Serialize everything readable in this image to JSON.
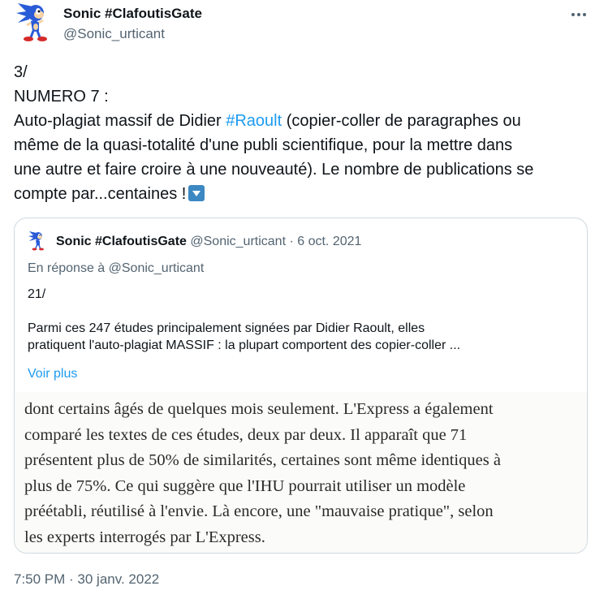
{
  "tweet": {
    "author": {
      "name": "Sonic #ClafoutisGate",
      "handle": "@Sonic_urticant"
    },
    "text": {
      "line1": "3/",
      "line2": "NUMERO 7 :",
      "line3_before": "Auto-plagiat massif de Didier ",
      "hashtag": "#Raoult",
      "line3_after": " (copier-coller de paragraphes ou",
      "line4": "même de la quasi-totalité d'une publi scientifique, pour la mettre dans",
      "line5": "une autre et faire croire à une nouveauté). Le nombre de publications se",
      "line6": "compte par...centaines !"
    },
    "timestamp": "7:50 PM · 30 janv. 2022",
    "more_icon": "more-dots-icon"
  },
  "quote": {
    "author": {
      "name": "Sonic #ClafoutisGate",
      "handle": "@Sonic_urticant",
      "date": "6 oct. 2021"
    },
    "separator": " · ",
    "reply_to": "En réponse à @Sonic_urticant",
    "text": {
      "line1": "21/",
      "line2": "Parmi ces 247 études principalement signées par Didier Raoult, elles",
      "line3": "pratiquent l'auto-plagiat MASSIF : la plupart comportent des copier-coller ..."
    },
    "see_more": "Voir plus",
    "media_lines": [
      "dont certains âgés de quelques mois seulement. L'Express a également",
      "comparé les textes de ces études, deux par deux. Il apparaît que 71",
      "présentent plus de 50% de similarités, certaines sont même identiques à",
      "plus de 75%. Ce qui suggère que l'IHU pourrait utiliser un modèle",
      "préétabli, réutilisé à l'envie. Là encore, une \"mauvaise pratique\", selon",
      "les experts interrogés par L'Express."
    ]
  },
  "colors": {
    "accent": "#1d9bf0",
    "secondary_text": "#536471",
    "border": "#cfd9de",
    "emoji_blue": "#3b88c3"
  }
}
